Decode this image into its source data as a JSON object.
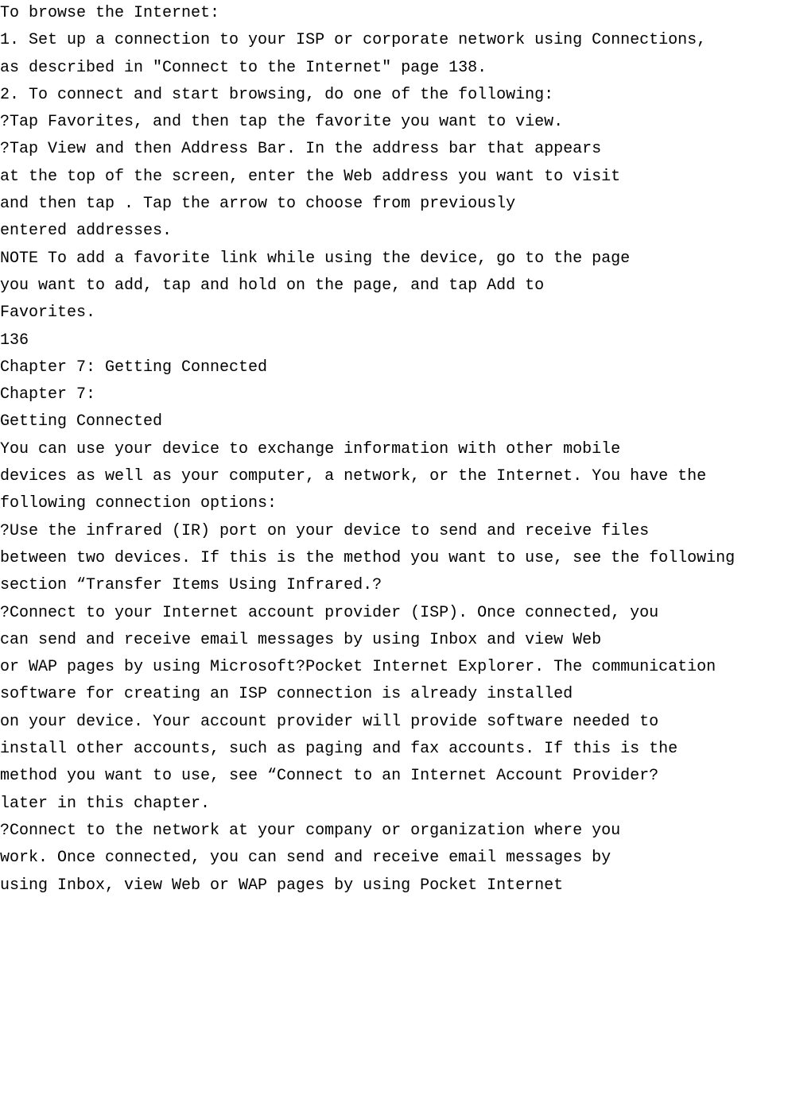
{
  "lines": [
    "To browse the Internet:",
    "1. Set up a connection to your ISP or corporate network using Connections,",
    "as described in \"Connect to the Internet\" page 138.",
    "2. To connect and start browsing, do one of the following:",
    "?Tap Favorites, and then tap the favorite you want to view.",
    "?Tap View and then Address Bar. In the address bar that appears",
    "at the top of the screen, enter the Web address you want to visit",
    "and then tap . Tap the arrow to choose from previously",
    "entered addresses.",
    "NOTE To add a favorite link while using the device, go to the page",
    "you want to add, tap and hold on the page, and tap Add to",
    "Favorites.",
    "136",
    "Chapter 7: Getting Connected",
    "Chapter 7:",
    "Getting Connected",
    "You can use your device to exchange information with other mobile",
    "devices as well as your computer, a network, or the Internet. You have the",
    "following connection options:",
    "?Use the infrared (IR) port on your device to send and receive files",
    "between two devices. If this is the method you want to use, see the following",
    "section “Transfer Items Using Infrared.?",
    "?Connect to your Internet account provider (ISP). Once connected, you",
    "can send and receive email messages by using Inbox and view Web",
    "or WAP pages by using Microsoft?Pocket Internet Explorer. The communication",
    "software for creating an ISP connection is already installed",
    "on your device. Your account provider will provide software needed to",
    "install other accounts, such as paging and fax accounts. If this is the",
    "method you want to use, see “Connect to an Internet Account Provider?",
    "later in this chapter.",
    "?Connect to the network at your company or organization where you",
    "work. Once connected, you can send and receive email messages by",
    "using Inbox, view Web or WAP pages by using Pocket Internet"
  ]
}
